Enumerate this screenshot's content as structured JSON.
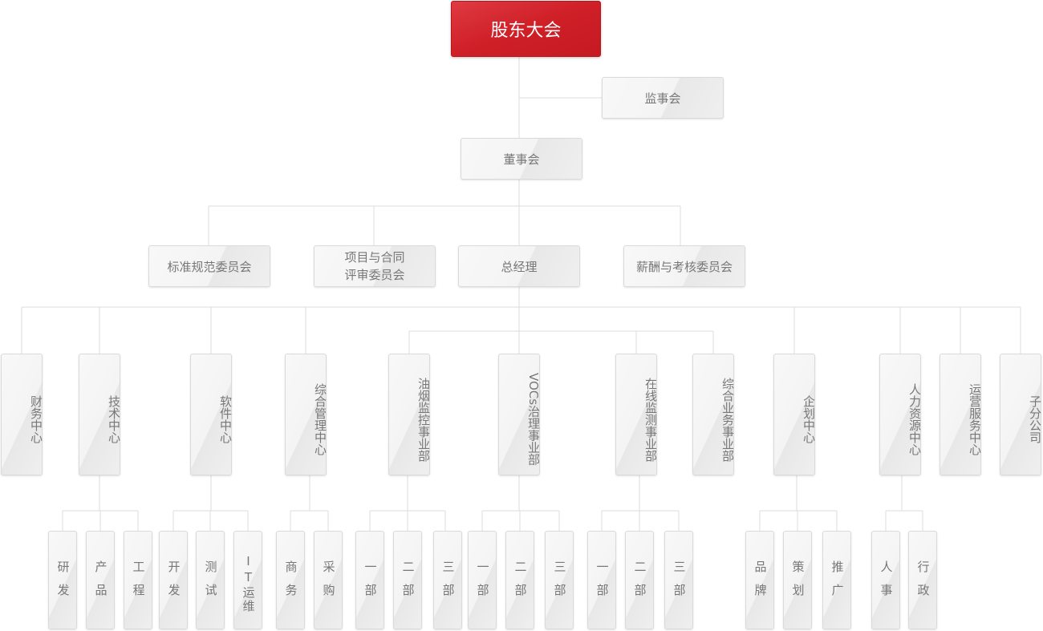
{
  "top": {
    "shareholders": "股东大会",
    "supervisors": "监事会",
    "board": "董事会"
  },
  "committees": {
    "standards": "标准规范委员会",
    "project_line1": "项目与合同",
    "project_line2": "评审委员会",
    "gm": "总经理",
    "compensation": "薪酬与考核委员会"
  },
  "departments": [
    "财务中心",
    "技术中心",
    "软件中心",
    "综合管理中心",
    "油烟监控事业部",
    "VOCs治理事业部",
    "在线监测事业部",
    "综合业务事业部",
    "企划中心",
    "人力资源中心",
    "运营服务中心",
    "子分公司"
  ],
  "subunits": [
    "研发",
    "产品",
    "工程",
    "开发",
    "测试",
    "IT运维",
    "商务",
    "采购",
    "一部",
    "二部",
    "三部",
    "一部",
    "二部",
    "三部",
    "一部",
    "二部",
    "三部",
    "品牌",
    "策划",
    "推广",
    "人事",
    "行政"
  ],
  "colors": {
    "accent": "#d0222a",
    "line": "#dcdcdc",
    "text": "#777777"
  }
}
